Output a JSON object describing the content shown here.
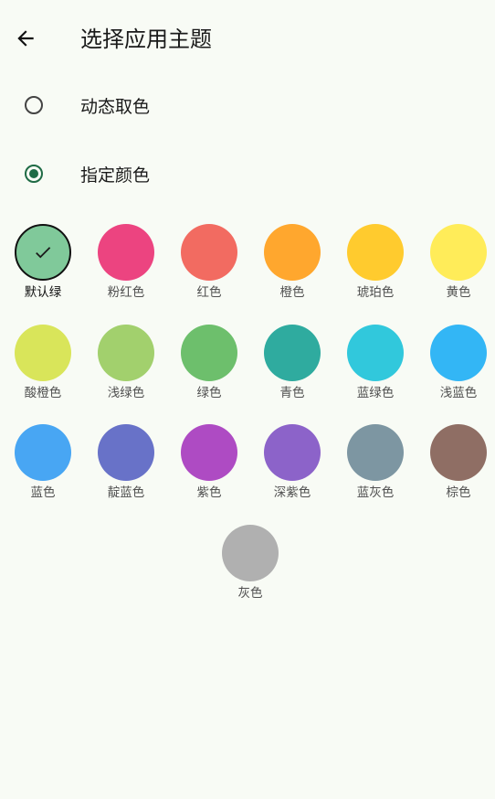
{
  "header": {
    "title": "选择应用主题",
    "back_icon": "arrow-left-icon"
  },
  "options": [
    {
      "label": "动态取色",
      "checked": false
    },
    {
      "label": "指定颜色",
      "checked": true
    }
  ],
  "colors": [
    {
      "label": "默认绿",
      "color": "#80c99a",
      "selected": true
    },
    {
      "label": "粉红色",
      "color": "#ec4480",
      "selected": false
    },
    {
      "label": "红色",
      "color": "#f26b61",
      "selected": false
    },
    {
      "label": "橙色",
      "color": "#ffa72e",
      "selected": false
    },
    {
      "label": "琥珀色",
      "color": "#ffcb2e",
      "selected": false
    },
    {
      "label": "黄色",
      "color": "#ffec59",
      "selected": false
    },
    {
      "label": "酸橙色",
      "color": "#d9e55a",
      "selected": false
    },
    {
      "label": "浅绿色",
      "color": "#a2d06d",
      "selected": false
    },
    {
      "label": "绿色",
      "color": "#6dbf6c",
      "selected": false
    },
    {
      "label": "青色",
      "color": "#2fab9f",
      "selected": false
    },
    {
      "label": "蓝绿色",
      "color": "#31c8dc",
      "selected": false
    },
    {
      "label": "浅蓝色",
      "color": "#33b6f5",
      "selected": false
    },
    {
      "label": "蓝色",
      "color": "#48a6f3",
      "selected": false
    },
    {
      "label": "靛蓝色",
      "color": "#6872c8",
      "selected": false
    },
    {
      "label": "紫色",
      "color": "#ae4bc3",
      "selected": false
    },
    {
      "label": "深紫色",
      "color": "#8c63c9",
      "selected": false
    },
    {
      "label": "蓝灰色",
      "color": "#7d96a2",
      "selected": false
    },
    {
      "label": "棕色",
      "color": "#8f6e64",
      "selected": false
    },
    {
      "label": "灰色",
      "color": "#b0b0b0",
      "selected": false
    }
  ]
}
